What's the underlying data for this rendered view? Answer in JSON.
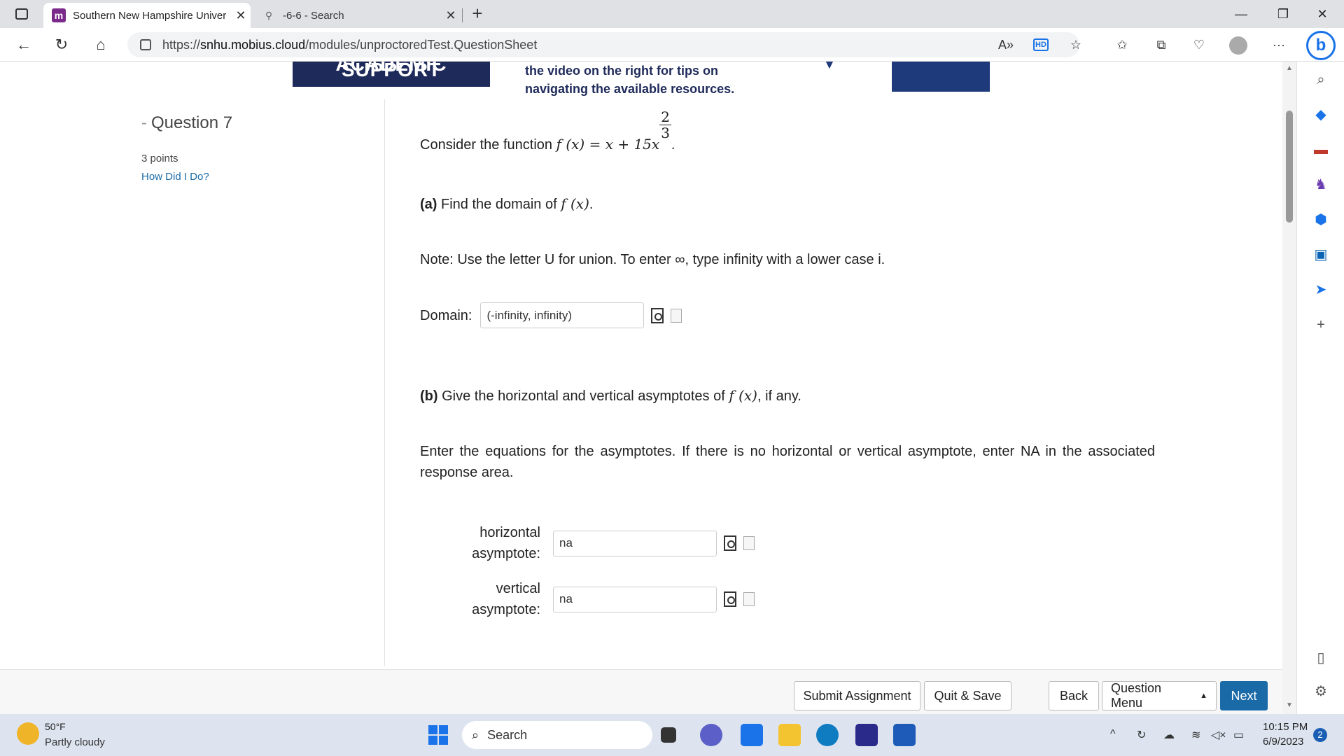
{
  "browser": {
    "tabs": [
      {
        "title": "Southern New Hampshire Univer",
        "favicon": "m",
        "active": true
      },
      {
        "title": "-6-6 - Search",
        "favicon": "search-icon",
        "active": false
      }
    ],
    "close_glyph": "✕",
    "new_tab_glyph": "+",
    "window_controls": {
      "minimize": "—",
      "restore": "❐",
      "close": "✕"
    },
    "url": {
      "prefix": "https://",
      "host": "snhu.mobius.cloud",
      "path": "/modules/unproctoredTest.QuestionSheet"
    },
    "hd_badge": "HD",
    "read_aloud": "A»",
    "more": "···",
    "bing": "b"
  },
  "banner": {
    "left_text": "ACADEMIC SUPPORT",
    "middle_line1": "the video on the right for tips on",
    "middle_line2": "navigating the available resources."
  },
  "question": {
    "title": "Question 7",
    "points": "3 points",
    "how_did_i_do": "How Did I Do?"
  },
  "content": {
    "intro": "Consider the function",
    "function_lhs": "f (x) = x + 15x",
    "exponent_num": "2",
    "exponent_den": "3",
    "part_a_label": "(a)",
    "part_a_text": "Find the domain of",
    "f_of_x": "f (x)",
    "note": "Note: Use the letter U for union. To enter ∞, type infinity with a lower case i.",
    "domain_label": "Domain:",
    "domain_value": "(-infinity, infinity)",
    "part_b_label": "(b)",
    "part_b_text": "Give the horizontal and vertical asymptotes of",
    "part_b_suffix": ", if any.",
    "instructions": "Enter the equations for the asymptotes. If there is no horizontal or vertical asymptote, enter NA in the associated response area.",
    "horizontal_label_1": "horizontal",
    "horizontal_label_2": "asymptote:",
    "horizontal_value": "na",
    "vertical_label_1": "vertical",
    "vertical_label_2": "asymptote:",
    "vertical_value": "na"
  },
  "footer": {
    "submit": "Submit Assignment",
    "quit_save": "Quit & Save",
    "back": "Back",
    "question_menu": "Question Menu",
    "next": "Next",
    "accent": "#1a6aa8"
  },
  "taskbar": {
    "temperature": "50°F",
    "condition": "Partly cloudy",
    "search_placeholder": "Search",
    "time": "10:15 PM",
    "date": "6/9/2023",
    "notification_count": "2"
  }
}
